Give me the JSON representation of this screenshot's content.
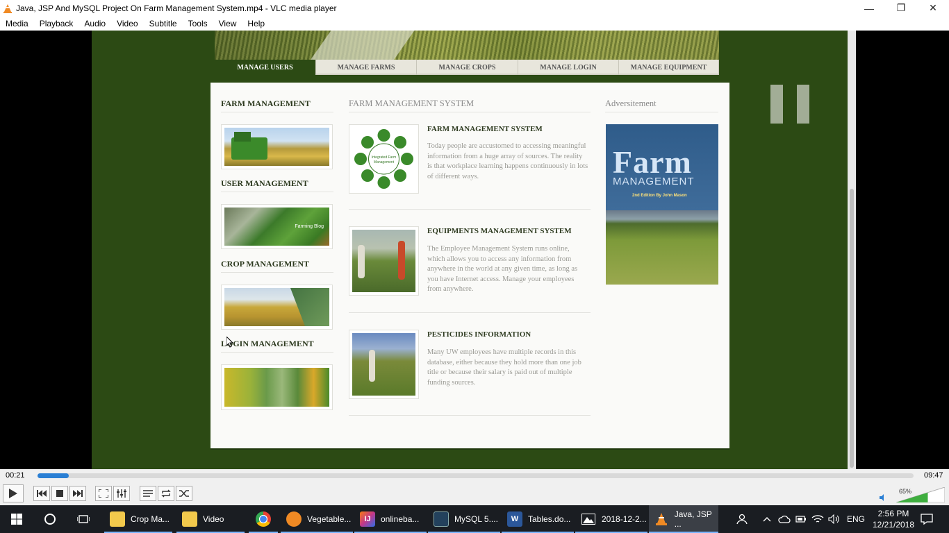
{
  "window": {
    "title": "Java, JSP And MySQL Project On Farm Management System.mp4 - VLC media player",
    "min": "—",
    "max": "❐",
    "close": "✕"
  },
  "menu": [
    "Media",
    "Playback",
    "Audio",
    "Video",
    "Subtitle",
    "Tools",
    "View",
    "Help"
  ],
  "site": {
    "nav": [
      "MANAGE USERS",
      "MANAGE FARMS",
      "MANAGE CROPS",
      "MANAGE LOGIN",
      "MANAGE EQUIPMENT"
    ],
    "sidebar": [
      "FARM MANAGEMENT",
      "USER MANAGEMENT",
      "CROP MANAGEMENT",
      "LOGIN MANAGEMENT"
    ],
    "main_heading": "FARM MANAGEMENT SYSTEM",
    "ad_heading": "Adversitement",
    "articles": [
      {
        "title": "FARM MANAGEMENT SYSTEM",
        "text": "Today people are accustomed to accessing meaningful information from a huge array of sources. The reality is that workplace learning happens continuously in lots of different ways.",
        "image_caption": "Integrated Farm Management"
      },
      {
        "title": "EQUIPMENTS MANAGEMENT SYSTEM",
        "text": "The Employee Management System runs online, which allows you to access any information from anywhere in the world at any given time, as long as you have Internet access. Manage your employees from anywhere."
      },
      {
        "title": "PESTICIDES INFORMATION",
        "text": "Many UW employees have multiple records in this database, either because they hold more than one job title or because their salary is paid out of multiple funding sources."
      }
    ],
    "thumb_caption": "Farming Blog",
    "book": {
      "title": "Farm",
      "subtitle": "MANAGEMENT",
      "edition": "2nd Edition By John Mason"
    }
  },
  "player": {
    "elapsed": "00:21",
    "total": "09:47",
    "progress": 0.036,
    "volume": "65%",
    "volume_level": 0.65
  },
  "taskbar": {
    "apps": [
      {
        "label": "Crop Ma...",
        "icon": "folder-icon",
        "color": "#f2c94c"
      },
      {
        "label": "Video",
        "icon": "folder-icon",
        "color": "#f2c94c"
      },
      {
        "label": "",
        "icon": "chrome-icon",
        "color": "#e04a3a"
      },
      {
        "label": "Vegetable...",
        "icon": "uc-browser-icon",
        "color": "#f08a24"
      },
      {
        "label": "onlineba...",
        "icon": "intellij-icon",
        "color": "#c2378a"
      },
      {
        "label": "MySQL 5....",
        "icon": "mysql-icon",
        "color": "#23415c"
      },
      {
        "label": "Tables.do...",
        "icon": "word-icon",
        "color": "#2b579a"
      },
      {
        "label": "2018-12-2...",
        "icon": "photos-icon",
        "color": "#ffffff"
      },
      {
        "label": "Java, JSP ...",
        "icon": "vlc-icon",
        "color": "#f08a24"
      }
    ],
    "lang": "ENG",
    "time": "2:56 PM",
    "date": "12/21/2018"
  }
}
